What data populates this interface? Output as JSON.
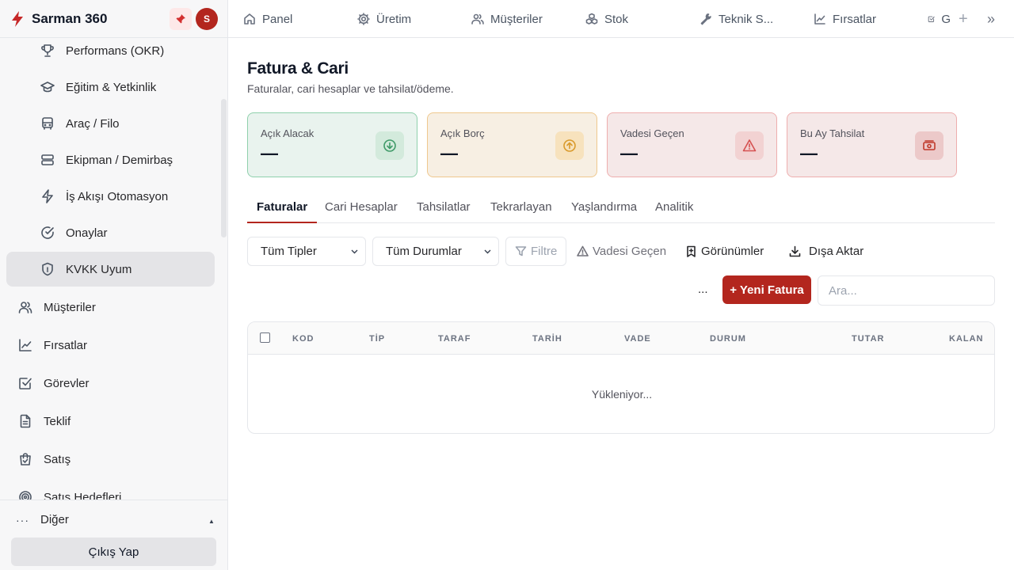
{
  "app": {
    "title": "Sarman 360",
    "avatar_initial": "S"
  },
  "sidebar": {
    "sub_items": [
      {
        "label": "Performans (OKR)",
        "icon": "trophy-icon"
      },
      {
        "label": "Eğitim & Yetkinlik",
        "icon": "graduation-cap-icon"
      },
      {
        "label": "Araç / Filo",
        "icon": "bus-icon"
      },
      {
        "label": "Ekipman / Demirbaş",
        "icon": "server-icon"
      },
      {
        "label": "İş Akışı Otomasyon",
        "icon": "lightning-icon"
      },
      {
        "label": "Onaylar",
        "icon": "check-circle-icon"
      },
      {
        "label": "KVKK Uyum",
        "icon": "shield-icon",
        "active": true
      }
    ],
    "items": [
      {
        "label": "Müşteriler",
        "icon": "users-icon"
      },
      {
        "label": "Fırsatlar",
        "icon": "chart-line-icon"
      },
      {
        "label": "Görevler",
        "icon": "checkbox-icon"
      },
      {
        "label": "Teklif",
        "icon": "file-icon"
      },
      {
        "label": "Satış",
        "icon": "shopping-bag-icon"
      },
      {
        "label": "Satış Hedefleri",
        "icon": "target-icon"
      }
    ],
    "more_label": "Diğer",
    "logout_label": "Çıkış Yap"
  },
  "topnav": {
    "items": [
      {
        "label": "Panel",
        "icon": "home-icon"
      },
      {
        "label": "Üretim",
        "icon": "gear-icon"
      },
      {
        "label": "Müşteriler",
        "icon": "users-icon"
      },
      {
        "label": "Stok",
        "icon": "boxes-icon"
      },
      {
        "label": "Teknik S...",
        "icon": "wrench-icon"
      },
      {
        "label": "Fırsatlar",
        "icon": "chart-line-icon"
      },
      {
        "label": "G",
        "icon": "checkbox-icon"
      }
    ]
  },
  "page": {
    "title": "Fatura & Cari",
    "subtitle": "Faturalar, cari hesaplar ve tahsilat/ödeme."
  },
  "cards": [
    {
      "label": "Açık Alacak",
      "value": "—",
      "icon": "arrow-down-circle-icon",
      "bg": "#e9f3ee",
      "border": "#8fd0ac",
      "icon_bg": "#d3eadc",
      "icon_color": "#3f9a68"
    },
    {
      "label": "Açık Borç",
      "value": "—",
      "icon": "arrow-up-circle-icon",
      "bg": "#f7efe3",
      "border": "#efc88e",
      "icon_bg": "#f7e2bd",
      "icon_color": "#d99a2b"
    },
    {
      "label": "Vadesi Geçen",
      "value": "—",
      "icon": "warning-icon",
      "bg": "#f5e8e8",
      "border": "#eeaeae",
      "icon_bg": "#f2d2d2",
      "icon_color": "#d55050"
    },
    {
      "label": "Bu Ay Tahsilat",
      "value": "—",
      "icon": "cash-icon",
      "bg": "#f5e8e8",
      "border": "#eeaeae",
      "icon_bg": "#ecc9c9",
      "icon_color": "#c0392b"
    }
  ],
  "tabs": [
    "Faturalar",
    "Cari Hesaplar",
    "Tahsilatlar",
    "Tekrarlayan",
    "Yaşlandırma",
    "Analitik"
  ],
  "toolbar": {
    "type_select": "Tüm Tipler",
    "status_select": "Tüm Durumlar",
    "filter_label": "Filtre",
    "overdue_label": "Vadesi Geçen",
    "views_label": "Görünümler",
    "export_label": "Dışa Aktar",
    "more_label": "...",
    "new_label": "+ Yeni Fatura",
    "search_placeholder": "Ara..."
  },
  "table": {
    "columns": [
      "KOD",
      "TİP",
      "TARAF",
      "TARİH",
      "VADE",
      "DURUM",
      "TUTAR",
      "KALAN"
    ],
    "loading_text": "Yükleniyor..."
  },
  "colors": {
    "accent": "#b3261e"
  }
}
